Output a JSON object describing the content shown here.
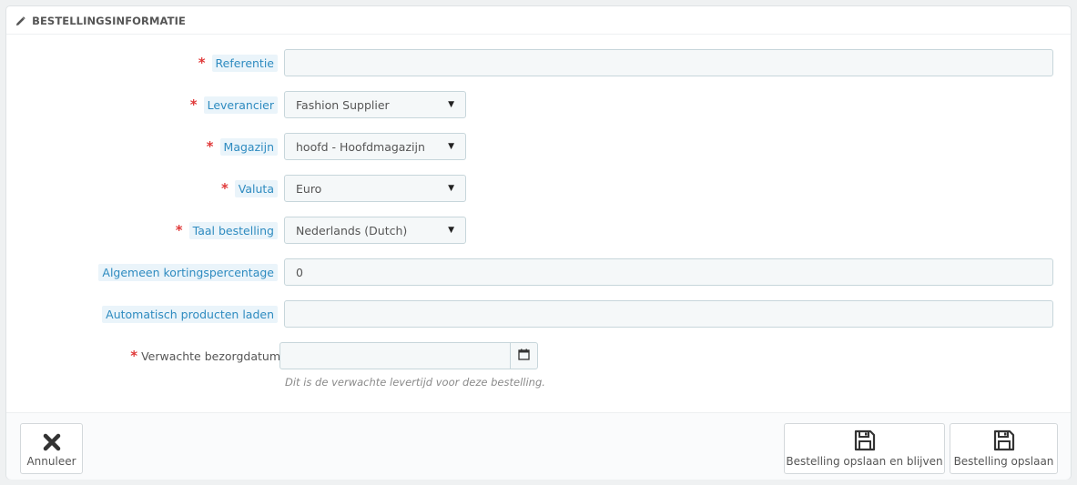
{
  "panel": {
    "title": "BESTELLINGSINFORMATIE",
    "title_icon": "pencil-icon"
  },
  "form": {
    "reference": {
      "label": "Referentie",
      "required": "*",
      "value": ""
    },
    "supplier": {
      "label": "Leverancier",
      "required": "*",
      "selected": "Fashion Supplier"
    },
    "warehouse": {
      "label": "Magazijn",
      "required": "*",
      "selected": "hoofd - Hoofdmagazijn"
    },
    "currency": {
      "label": "Valuta",
      "required": "*",
      "selected": "Euro"
    },
    "order_language": {
      "label": "Taal bestelling",
      "required": "*",
      "selected": "Nederlands (Dutch)"
    },
    "discount": {
      "label": "Algemeen kortingspercentage",
      "value": "0"
    },
    "autoload": {
      "label": "Automatisch producten laden",
      "value": ""
    },
    "expected_date": {
      "label": "Verwachte bezorgdatum",
      "required": "*",
      "value": "",
      "help": "Dit is de verwachte levertijd voor deze bestelling.",
      "icon": "calendar-icon"
    }
  },
  "footer": {
    "cancel_label": "Annuleer",
    "cancel_icon": "close-icon",
    "save_stay_label": "Bestelling opslaan en blijven",
    "save_stay_icon": "save-icon",
    "save_label": "Bestelling opslaan",
    "save_icon": "save-icon"
  }
}
